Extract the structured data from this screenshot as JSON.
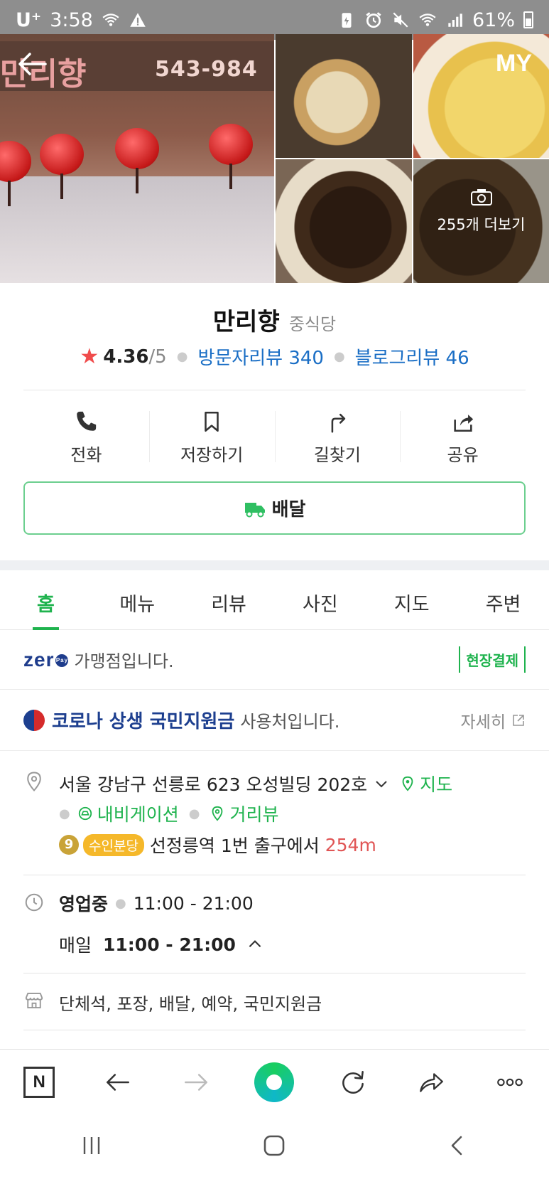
{
  "status_bar": {
    "carrier": "U⁺",
    "time": "3:58",
    "battery": "61%"
  },
  "header": {
    "my_label": "MY",
    "sign_text": "543-984",
    "sign_name": "만리향",
    "more_photos_label": "255개 더보기"
  },
  "place": {
    "name": "만리향",
    "category": "중식당",
    "rating": "4.36",
    "rating_max": "/5",
    "visitor_reviews": "방문자리뷰 340",
    "blog_reviews": "블로그리뷰 46"
  },
  "actions": [
    {
      "label": "전화",
      "icon": "phone-icon"
    },
    {
      "label": "저장하기",
      "icon": "bookmark-icon"
    },
    {
      "label": "길찾기",
      "icon": "directions-icon"
    },
    {
      "label": "공유",
      "icon": "share-icon"
    }
  ],
  "delivery": {
    "label": "배달",
    "icon": "delivery-truck-icon"
  },
  "tabs": [
    {
      "label": "홈",
      "active": true
    },
    {
      "label": "메뉴"
    },
    {
      "label": "리뷰"
    },
    {
      "label": "사진"
    },
    {
      "label": "지도"
    },
    {
      "label": "주변"
    }
  ],
  "zeropay": {
    "logo": "zer",
    "logo_badge": "Pay",
    "text": "가맹점입니다.",
    "badge": "현장결제"
  },
  "corona": {
    "title": "코로나 상생 국민지원금",
    "text": "사용처입니다.",
    "detail_link": "자세히"
  },
  "address": {
    "text": "서울 강남구 선릉로 623 오성빌딩 202호",
    "map_link": "지도",
    "navigation_link": "내비게이션",
    "street_view_link": "거리뷰",
    "subway_line_no": "9",
    "subway_line_name": "수인분당",
    "station": "선정릉역 1번 출구에서",
    "distance": "254m"
  },
  "hours": {
    "status": "영업중",
    "today": "11:00 - 21:00",
    "schedule_day": "매일",
    "schedule_time": "11:00 - 21:00"
  },
  "amenities": {
    "text": "단체석, 포장, 배달, 예약, 국민지원금"
  },
  "colors": {
    "accent_green": "#1fb34e",
    "link_blue": "#1a6ec5",
    "star_red": "#f04c4c",
    "distance_red": "#e05555"
  }
}
